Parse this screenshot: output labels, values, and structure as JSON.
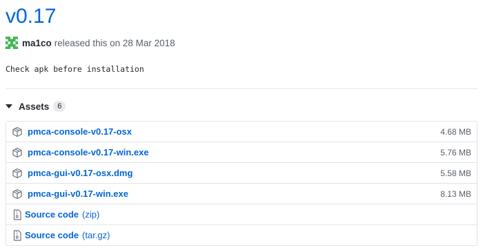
{
  "release": {
    "title": "v0.17",
    "author": "ma1co",
    "released_text": "released this on 28 Mar 2018",
    "description": "Check apk before installation"
  },
  "assets": {
    "label": "Assets",
    "count": "6",
    "files": [
      {
        "name": "pmca-console-v0.17-osx",
        "size": "4.68 MB"
      },
      {
        "name": "pmca-console-v0.17-win.exe",
        "size": "5.76 MB"
      },
      {
        "name": "pmca-gui-v0.17-osx.dmg",
        "size": "5.58 MB"
      },
      {
        "name": "pmca-gui-v0.17-win.exe",
        "size": "8.13 MB"
      }
    ],
    "source": [
      {
        "label": "Source code",
        "format": "(zip)"
      },
      {
        "label": "Source code",
        "format": "(tar.gz)"
      }
    ]
  },
  "colors": {
    "link": "#0366d6",
    "avatar": "#3fb950",
    "muted": "#586069",
    "border": "#e1e4e8"
  },
  "icons": {
    "caret": "triangle-down-icon",
    "file": "package-icon",
    "source": "file-zip-icon",
    "avatar": "identicon"
  }
}
